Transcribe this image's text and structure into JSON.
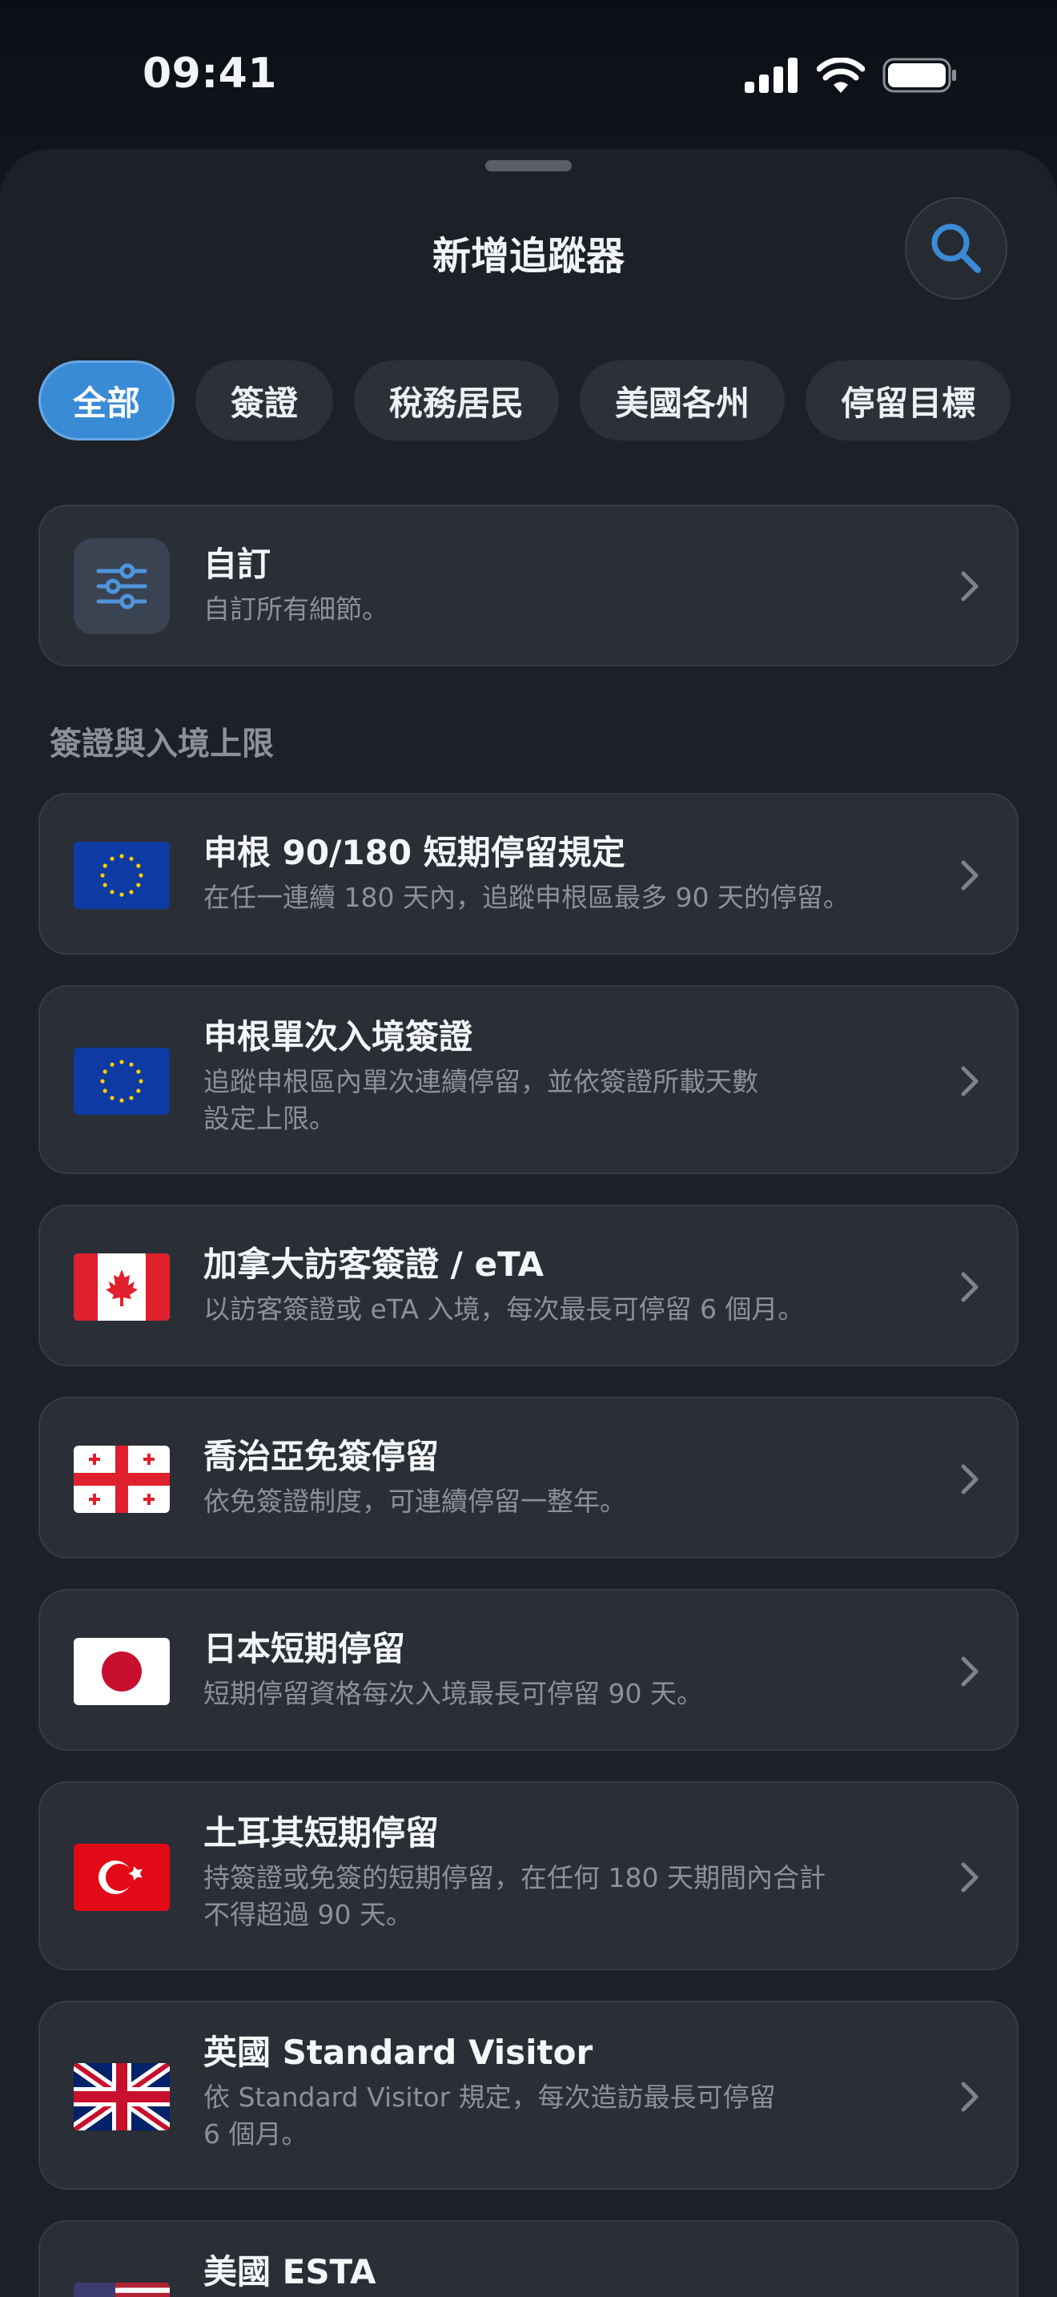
{
  "status": {
    "time": "09:41"
  },
  "sheet": {
    "title": "新增追蹤器"
  },
  "chips": [
    "全部",
    "簽證",
    "稅務居民",
    "美國各州",
    "停留目標"
  ],
  "custom": {
    "title": "自訂",
    "subtitle": "自訂所有細節。",
    "icon": "sliders-icon"
  },
  "section": {
    "label": "簽證與入境上限"
  },
  "items": [
    {
      "flag": "eu",
      "title": "申根 90/180 短期停留規定",
      "subtitle": "在任一連續 180 天內，追蹤申根區最多 90 天的停留。"
    },
    {
      "flag": "eu",
      "title": "申根單次入境簽證",
      "subtitle": "追蹤申根區內單次連續停留，並依簽證所載天數\n設定上限。"
    },
    {
      "flag": "ca",
      "title": "加拿大訪客簽證 / eTA",
      "subtitle": "以訪客簽證或 eTA 入境，每次最長可停留 6 個月。"
    },
    {
      "flag": "ge",
      "title": "喬治亞免簽停留",
      "subtitle": "依免簽證制度，可連續停留一整年。"
    },
    {
      "flag": "jp",
      "title": "日本短期停留",
      "subtitle": "短期停留資格每次入境最長可停留 90 天。"
    },
    {
      "flag": "tr",
      "title": "土耳其短期停留",
      "subtitle": "持簽證或免簽的短期停留，在任何 180 天期間內合計\n不得超過 90 天。"
    },
    {
      "flag": "gb",
      "title": "英國 Standard Visitor",
      "subtitle": "依 Standard Visitor 規定，每次造訪最長可停留\n6 個月。"
    },
    {
      "flag": "us",
      "title": "美國 ESTA",
      "subtitle": ""
    }
  ],
  "colors": {
    "accent": "#3a8bd6",
    "background": "#1d2026",
    "card": "#2a2e36"
  }
}
